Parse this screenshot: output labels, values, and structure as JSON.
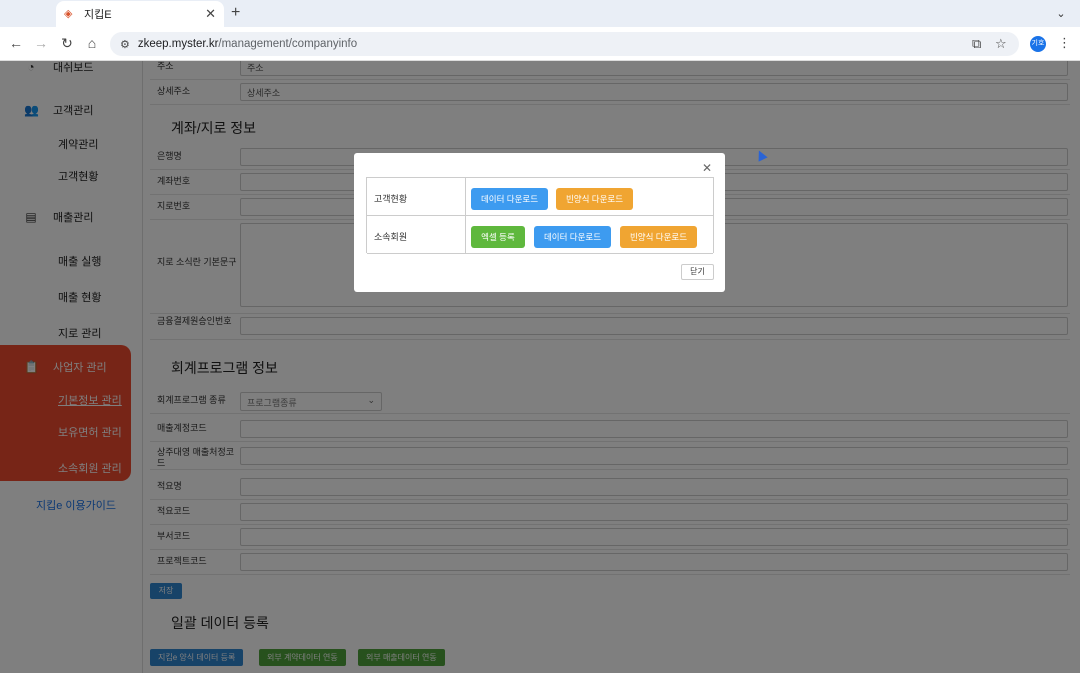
{
  "browser": {
    "tab_title": "지킵E",
    "url_host": "zkeep.myster.kr",
    "url_path": "/management/companyinfo",
    "profile_label": "기호"
  },
  "sidebar": {
    "dashboard": "대쉬보드",
    "customer_mgmt": "고객관리",
    "customer_subs": [
      "계약관리",
      "고객현황"
    ],
    "sales_mgmt": "매출관리",
    "sales_subs": [
      "매출 실행",
      "매출 현황",
      "지로 관리"
    ],
    "business_mgmt": "사업자 관리",
    "business_subs": [
      "기본정보 관리",
      "보유면허 관리",
      "소속회원 관리"
    ],
    "guide": "지킵e 이용가이드"
  },
  "form": {
    "address_label": "주소",
    "address_value": "주소",
    "detail_address_label": "상세주소",
    "detail_address_value": "상세주소",
    "account_section": "계좌/지로 정보",
    "bank_label": "은행명",
    "account_label": "계좌번호",
    "giro_label": "지로번호",
    "giro_text_label": "지로 소식란 기본문구",
    "finance_label": "금융결제원승인번호",
    "accounting_section": "회계프로그램 정보",
    "program_type_label": "회계프로그램 종류",
    "program_type_value": "프로그램종류",
    "sales_account_label": "매출계정코드",
    "sub_account_label": "상주대영 매출처정코드",
    "summary_label": "적요명",
    "summary_code_label": "적요코드",
    "dept_code_label": "부서코드",
    "project_code_label": "프로젝트코드",
    "save": "저장",
    "bulk_section": "일괄 데이터 등록",
    "bulk_buttons": [
      "지킵e 양식 데이터 등록",
      "외부 계약데이터 연동",
      "외부 매출데이터 연동"
    ]
  },
  "modal": {
    "rows": [
      {
        "label": "고객현황",
        "buttons": [
          "데이터 다운로드",
          "빈양식 다운로드"
        ]
      },
      {
        "label": "소속회원",
        "buttons": [
          "엑셀 등록",
          "데이터 다운로드",
          "빈양식 다운로드"
        ]
      }
    ],
    "close": "닫기"
  },
  "colors": {
    "sidebar_active": "#ef4a2e",
    "btn_blue": "#3d9bf0",
    "btn_orange": "#f0a532",
    "btn_green": "#5fb83d"
  }
}
